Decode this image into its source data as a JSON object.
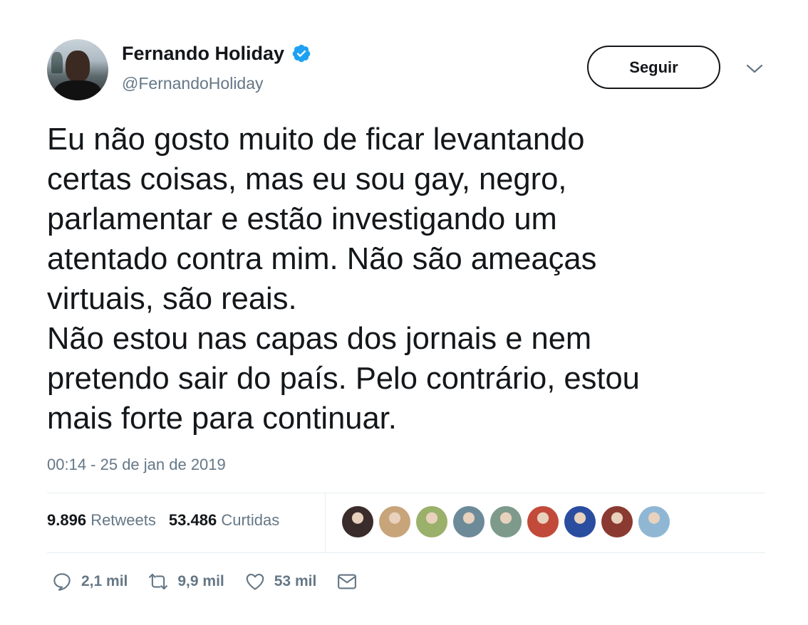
{
  "author": {
    "name": "Fernando Holiday",
    "handle": "@FernandoHoliday",
    "verified": true
  },
  "follow_button": {
    "label": "Seguir"
  },
  "tweet": {
    "lines": [
      "Eu não gosto muito de ficar levantando",
      "certas coisas, mas eu sou gay, negro,",
      "parlamentar e estão investigando um",
      "atentado contra mim. Não são ameaças",
      "virtuais, são reais.",
      "Não estou nas capas dos jornais e nem",
      "pretendo sair do país. Pelo contrário, estou",
      "mais forte para continuar."
    ],
    "timestamp": "00:14 - 25 de jan de 2019"
  },
  "stats": {
    "retweets_count": "9.896",
    "retweets_label": "Retweets",
    "likes_count": "53.486",
    "likes_label": "Curtidas"
  },
  "likers": [
    {
      "color": "#3a2c2a"
    },
    {
      "color": "#c8a47a"
    },
    {
      "color": "#9bb06a"
    },
    {
      "color": "#6d8a99"
    },
    {
      "color": "#7d9a8a"
    },
    {
      "color": "#c24a3a"
    },
    {
      "color": "#2a4da0"
    },
    {
      "color": "#8a3a30"
    },
    {
      "color": "#8fb7d4"
    }
  ],
  "actions": {
    "reply_count": "2,1 mil",
    "retweet_count": "9,9 mil",
    "like_count": "53 mil"
  },
  "colors": {
    "verified": "#1da1f2",
    "secondary_text": "#657786",
    "divider": "#e6ecf0"
  }
}
